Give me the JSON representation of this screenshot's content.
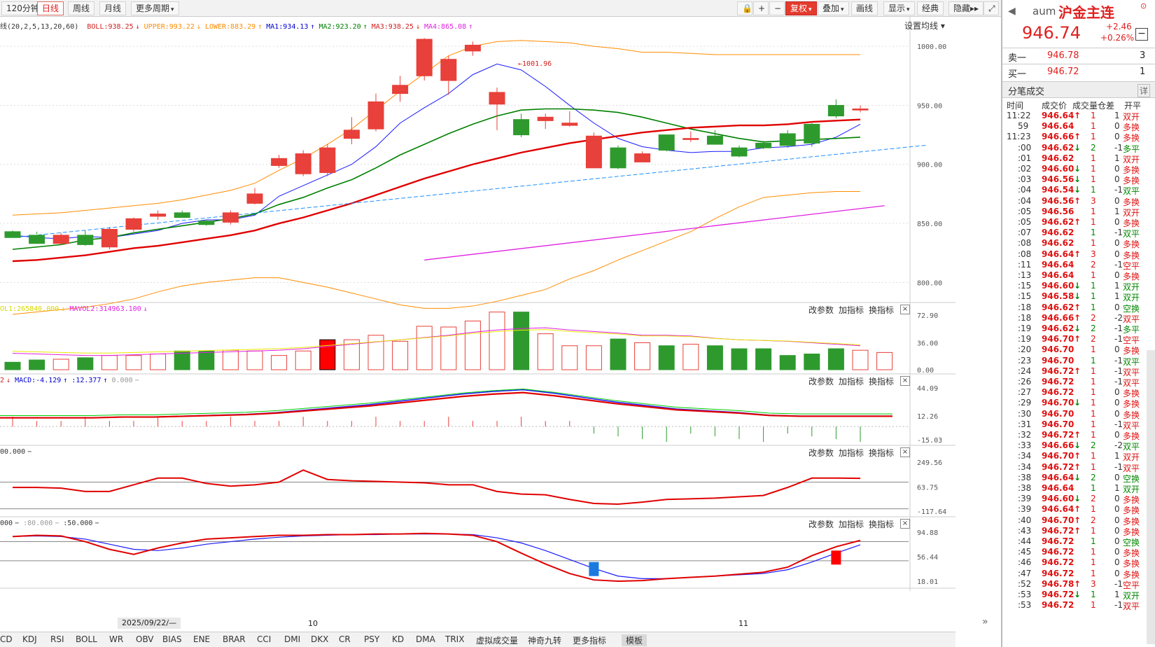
{
  "toolbar": {
    "left_buttons": [
      {
        "label": "120分钟"
      },
      {
        "label": "日线"
      },
      {
        "label": "周线"
      },
      {
        "label": "月线"
      },
      {
        "label": "更多周期"
      }
    ],
    "right_buttons": [
      {
        "label": "复权"
      },
      {
        "label": "叠加"
      },
      {
        "label": "画线"
      },
      {
        "label": "显示"
      },
      {
        "label": "经典"
      },
      {
        "label": "隐藏"
      }
    ],
    "icons": [
      "lock-icon",
      "plus-icon",
      "minus-icon",
      "expand-icon"
    ]
  },
  "main_indicator": {
    "prefix": "线(20,2,5,13,20,60)",
    "items": [
      {
        "text": "BOLL:938.25",
        "arrow": "↓",
        "color": "#d02020"
      },
      {
        "text": "UPPER:993.22",
        "arrow": "↓",
        "color": "#ff8c00"
      },
      {
        "text": "LOWER:883.29",
        "arrow": "↑",
        "color": "#ff8c00"
      },
      {
        "text": "MA1:934.13",
        "arrow": "↑",
        "color": "#0000cc"
      },
      {
        "text": "MA2:923.20",
        "arrow": "↑",
        "color": "#008000"
      },
      {
        "text": "MA3:938.25",
        "arrow": "↓",
        "color": "#d02020"
      },
      {
        "text": "MA4:865.08",
        "arrow": "↑",
        "color": "#e020e0"
      }
    ],
    "settings_label": "设置均线",
    "peak_label": "1001.96",
    "y_ticks": [
      "1000.00",
      "950.00",
      "900.00",
      "850.00",
      "800.00"
    ]
  },
  "panels": {
    "controls": [
      "改参数",
      "加指标",
      "换指标"
    ],
    "close": "×",
    "volume": {
      "legend": [
        {
          "text": "OL1:265840.000",
          "arrow": "↓",
          "color": "#d8d800"
        },
        {
          "text": "MAVOL2:314963.100",
          "arrow": "↓",
          "color": "#e020e0"
        }
      ],
      "y_ticks": [
        "72.90",
        "36.00",
        "0.00"
      ]
    },
    "macd": {
      "legend": [
        {
          "text": "2",
          "arrow": "↓",
          "color": "#d02020"
        },
        {
          "text": "MACD:-4.129",
          "arrow": "↑",
          "color": "#0000cc"
        },
        {
          "text": ":12.377",
          "arrow": "↑",
          "color": "#0000cc"
        },
        {
          "text": "0.000",
          "arrow": "−",
          "color": "#999999"
        }
      ],
      "y_ticks": [
        "44.09",
        "12.26",
        "-15.03"
      ]
    },
    "cci": {
      "legend": [
        {
          "text": "00.000",
          "arrow": "−",
          "color": "#333333"
        }
      ],
      "y_ticks": [
        "249.56",
        "63.75",
        "-117.64"
      ]
    },
    "kdj": {
      "legend": [
        {
          "text": "000",
          "arrow": "−",
          "color": "#333333"
        },
        {
          "text": ":80.000",
          "arrow": "−",
          "color": "#999999"
        },
        {
          "text": ":50.000",
          "arrow": "−",
          "color": "#333333"
        }
      ],
      "y_ticks": [
        "94.88",
        "56.44",
        "18.01"
      ]
    }
  },
  "x_axis": {
    "date_box": "2025/09/22/—",
    "month_labels": [
      "10",
      "11"
    ]
  },
  "bottom_tabs": [
    "CD",
    "KDJ",
    "RSI",
    "BOLL",
    "WR",
    "OBV",
    "BIAS",
    "ENE",
    "BRAR",
    "CCI",
    "DMI",
    "DKX",
    "CR",
    "PSY",
    "KD",
    "DMA",
    "TRIX",
    "虚拟成交量",
    "神奇九转",
    "更多指标",
    "模板"
  ],
  "quote": {
    "code": "aum",
    "name": "沪金主连",
    "price": "946.74",
    "change": "+2.46",
    "change_pct": "+0.26%",
    "sell_label": "卖一",
    "sell_price": "946.78",
    "sell_vol": "3",
    "buy_label": "买一",
    "buy_price": "946.72",
    "buy_vol": "1",
    "ticks_title": "分笔成交",
    "ticks_detail": "详",
    "col_headers": [
      "时间",
      "成交价",
      "成交量",
      "仓差",
      "开平"
    ]
  },
  "ticks": [
    [
      "11:22",
      "946.64",
      "↑",
      "1",
      "1",
      "双开",
      "r"
    ],
    [
      "59",
      "946.64",
      "",
      "1",
      "0",
      "多换",
      "r"
    ],
    [
      "11:23",
      "946.66",
      "↑",
      "1",
      "0",
      "多换",
      "r"
    ],
    [
      ":00",
      "946.62",
      "↓",
      "2",
      "-1",
      "多平",
      "g"
    ],
    [
      ":01",
      "946.62",
      "",
      "1",
      "1",
      "双开",
      "r"
    ],
    [
      ":02",
      "946.60",
      "↓",
      "1",
      "0",
      "多换",
      "r"
    ],
    [
      ":03",
      "946.56",
      "↓",
      "1",
      "0",
      "多换",
      "r"
    ],
    [
      ":04",
      "946.54",
      "↓",
      "1",
      "-1",
      "双平",
      "g"
    ],
    [
      ":04",
      "946.56",
      "↑",
      "3",
      "0",
      "多换",
      "r"
    ],
    [
      ":05",
      "946.56",
      "",
      "1",
      "1",
      "双开",
      "r"
    ],
    [
      ":05",
      "946.62",
      "↑",
      "1",
      "0",
      "多换",
      "r"
    ],
    [
      ":07",
      "946.62",
      "",
      "1",
      "-1",
      "双平",
      "g"
    ],
    [
      ":08",
      "946.62",
      "",
      "1",
      "0",
      "多换",
      "r"
    ],
    [
      ":08",
      "946.64",
      "↑",
      "3",
      "0",
      "多换",
      "r"
    ],
    [
      ":11",
      "946.64",
      "",
      "2",
      "-1",
      "空平",
      "r"
    ],
    [
      ":13",
      "946.64",
      "",
      "1",
      "0",
      "多换",
      "r"
    ],
    [
      ":15",
      "946.60",
      "↓",
      "1",
      "1",
      "双开",
      "g"
    ],
    [
      ":15",
      "946.58",
      "↓",
      "1",
      "1",
      "双开",
      "g"
    ],
    [
      ":18",
      "946.62",
      "↑",
      "1",
      "0",
      "空换",
      "g"
    ],
    [
      ":18",
      "946.66",
      "↑",
      "2",
      "-2",
      "双平",
      "r"
    ],
    [
      ":19",
      "946.62",
      "↓",
      "2",
      "-1",
      "多平",
      "g"
    ],
    [
      ":19",
      "946.70",
      "↑",
      "2",
      "-1",
      "空平",
      "r"
    ],
    [
      ":20",
      "946.70",
      "",
      "1",
      "0",
      "多换",
      "r"
    ],
    [
      ":23",
      "946.70",
      "",
      "1",
      "-1",
      "双平",
      "g"
    ],
    [
      ":24",
      "946.72",
      "↑",
      "1",
      "-1",
      "双平",
      "r"
    ],
    [
      ":26",
      "946.72",
      "",
      "1",
      "-1",
      "双平",
      "r"
    ],
    [
      ":27",
      "946.72",
      "",
      "1",
      "0",
      "多换",
      "r"
    ],
    [
      ":29",
      "946.70",
      "↓",
      "1",
      "0",
      "多换",
      "r"
    ],
    [
      ":30",
      "946.70",
      "",
      "1",
      "0",
      "多换",
      "r"
    ],
    [
      ":31",
      "946.70",
      "",
      "1",
      "-1",
      "双平",
      "r"
    ],
    [
      ":32",
      "946.72",
      "↑",
      "1",
      "0",
      "多换",
      "r"
    ],
    [
      ":33",
      "946.66",
      "↓",
      "2",
      "-2",
      "双平",
      "g"
    ],
    [
      ":34",
      "946.70",
      "↑",
      "1",
      "1",
      "双开",
      "r"
    ],
    [
      ":34",
      "946.72",
      "↑",
      "1",
      "-1",
      "双平",
      "r"
    ],
    [
      ":38",
      "946.64",
      "↓",
      "2",
      "0",
      "空换",
      "g"
    ],
    [
      ":38",
      "946.64",
      "",
      "1",
      "1",
      "双开",
      "g"
    ],
    [
      ":39",
      "946.60",
      "↓",
      "2",
      "0",
      "多换",
      "r"
    ],
    [
      ":39",
      "946.64",
      "↑",
      "1",
      "0",
      "多换",
      "r"
    ],
    [
      ":40",
      "946.70",
      "↑",
      "2",
      "0",
      "多换",
      "r"
    ],
    [
      ":43",
      "946.72",
      "↑",
      "1",
      "0",
      "多换",
      "r"
    ],
    [
      ":44",
      "946.72",
      "",
      "1",
      "0",
      "空换",
      "g"
    ],
    [
      ":45",
      "946.72",
      "",
      "1",
      "0",
      "多换",
      "r"
    ],
    [
      ":46",
      "946.72",
      "",
      "1",
      "0",
      "多换",
      "r"
    ],
    [
      ":47",
      "946.72",
      "",
      "1",
      "0",
      "多换",
      "r"
    ],
    [
      ":52",
      "946.78",
      "↑",
      "3",
      "-1",
      "空平",
      "r"
    ],
    [
      ":53",
      "946.72",
      "↓",
      "1",
      "1",
      "双开",
      "g"
    ],
    [
      ":53",
      "946.72",
      "",
      "1",
      "-1",
      "双平",
      "r"
    ]
  ],
  "chart_data": {
    "type": "candlestick",
    "y_range": [
      783,
      1025
    ],
    "candles": [
      [
        843,
        838,
        841,
        844
      ],
      [
        840,
        833,
        841,
        843
      ],
      [
        833,
        840,
        832,
        842
      ],
      [
        840,
        832,
        844,
        831
      ],
      [
        830,
        845,
        828,
        847
      ],
      [
        845,
        854,
        843,
        855
      ],
      [
        856,
        858,
        853,
        861
      ],
      [
        859,
        855,
        861,
        855
      ],
      [
        852,
        849,
        853,
        848
      ],
      [
        851,
        859,
        849,
        861
      ],
      [
        867,
        875,
        866,
        880
      ],
      [
        899,
        905,
        897,
        908
      ],
      [
        892,
        909,
        890,
        912
      ],
      [
        893,
        914,
        890,
        917
      ],
      [
        922,
        929,
        917,
        940
      ],
      [
        930,
        953,
        928,
        960
      ],
      [
        960,
        967,
        953,
        975
      ],
      [
        975,
        1006,
        971,
        1007
      ],
      [
        971,
        989,
        959,
        992
      ],
      [
        996,
        1001,
        992,
        1004
      ],
      [
        951,
        961,
        929,
        965
      ],
      [
        938,
        925,
        923,
        943
      ],
      [
        937,
        940,
        930,
        943
      ],
      [
        933,
        935,
        932,
        945
      ],
      [
        897,
        924,
        897,
        927
      ],
      [
        914,
        897,
        896,
        916
      ],
      [
        902,
        909,
        902,
        911
      ],
      [
        925,
        912,
        911,
        925
      ],
      [
        921,
        922,
        919,
        928
      ],
      [
        924,
        917,
        917,
        929
      ],
      [
        914,
        907,
        906,
        916
      ],
      [
        918,
        914,
        913,
        920
      ],
      [
        926,
        916,
        914,
        929
      ],
      [
        934,
        918,
        915,
        935
      ],
      [
        950,
        941,
        939,
        955
      ],
      [
        946,
        947,
        944,
        950
      ]
    ],
    "ma_boll_mid": [
      818,
      819,
      821,
      823,
      826,
      829,
      831,
      834,
      837,
      840,
      844,
      850,
      855,
      861,
      867,
      874,
      881,
      888,
      894,
      900,
      905,
      910,
      914,
      918,
      921,
      924,
      927,
      929,
      931,
      932,
      933,
      933,
      934,
      936,
      937,
      938
    ],
    "boll_upper": [
      857,
      858,
      859,
      861,
      863,
      865,
      867,
      870,
      874,
      878,
      884,
      895,
      905,
      917,
      930,
      946,
      962,
      977,
      992,
      1000,
      1004,
      1005,
      1004,
      1003,
      1000,
      998,
      995,
      995,
      994,
      993,
      993,
      993,
      993,
      993,
      993,
      993
    ],
    "boll_lower": [
      773,
      775,
      777,
      779,
      782,
      786,
      792,
      797,
      800,
      802,
      804,
      804,
      800,
      796,
      791,
      786,
      781,
      778,
      778,
      780,
      784,
      789,
      794,
      803,
      810,
      819,
      827,
      835,
      843,
      854,
      864,
      872,
      874,
      876,
      877,
      877
    ],
    "ma1": [
      840,
      838,
      837,
      839,
      838,
      841,
      844,
      850,
      853,
      853,
      857,
      873,
      882,
      891,
      900,
      915,
      935,
      948,
      960,
      976,
      985,
      980,
      966,
      950,
      935,
      922,
      915,
      912,
      910,
      911,
      911,
      914,
      915,
      917,
      923,
      934
    ],
    "ma2": [
      828,
      830,
      832,
      836,
      838,
      842,
      845,
      848,
      851,
      854,
      858,
      866,
      872,
      880,
      887,
      897,
      908,
      917,
      926,
      934,
      941,
      946,
      947,
      947,
      946,
      944,
      940,
      935,
      930,
      926,
      922,
      919,
      920,
      921,
      922,
      923
    ],
    "ma4_x": [
      17,
      36
    ],
    "ma4": [
      819,
      865
    ],
    "trend_line": [
      [
        0,
        838
      ],
      [
        36,
        921
      ]
    ],
    "volume": {
      "y_max": 72.9,
      "values": [
        10,
        13,
        14,
        16,
        19,
        19,
        21,
        25,
        25,
        26,
        25,
        19,
        25,
        40,
        40,
        46,
        38,
        58,
        57,
        65,
        77,
        77,
        48,
        32,
        32,
        41,
        36,
        32,
        34,
        32,
        28,
        28,
        19,
        21,
        28,
        26,
        23
      ],
      "mavol": [
        22,
        21,
        20,
        19,
        19,
        20,
        21,
        22,
        23,
        24,
        25,
        26,
        28,
        31,
        34,
        37,
        40,
        43,
        46,
        50,
        53,
        55,
        56,
        53,
        51,
        49,
        46,
        46,
        45,
        42,
        40,
        39,
        38,
        36,
        34,
        32
      ]
    },
    "macd": {
      "y_range": [
        -15.03,
        44.09
      ],
      "dif": [
        10,
        10,
        10,
        10,
        11,
        11,
        12,
        13,
        14,
        16,
        19,
        22,
        25,
        29,
        33,
        37,
        40,
        42,
        38,
        33,
        28,
        24,
        20,
        18,
        16,
        13,
        12,
        12,
        12,
        12
      ]
    },
    "kdj": {
      "y_range": [
        18.01,
        94.88
      ]
    }
  }
}
